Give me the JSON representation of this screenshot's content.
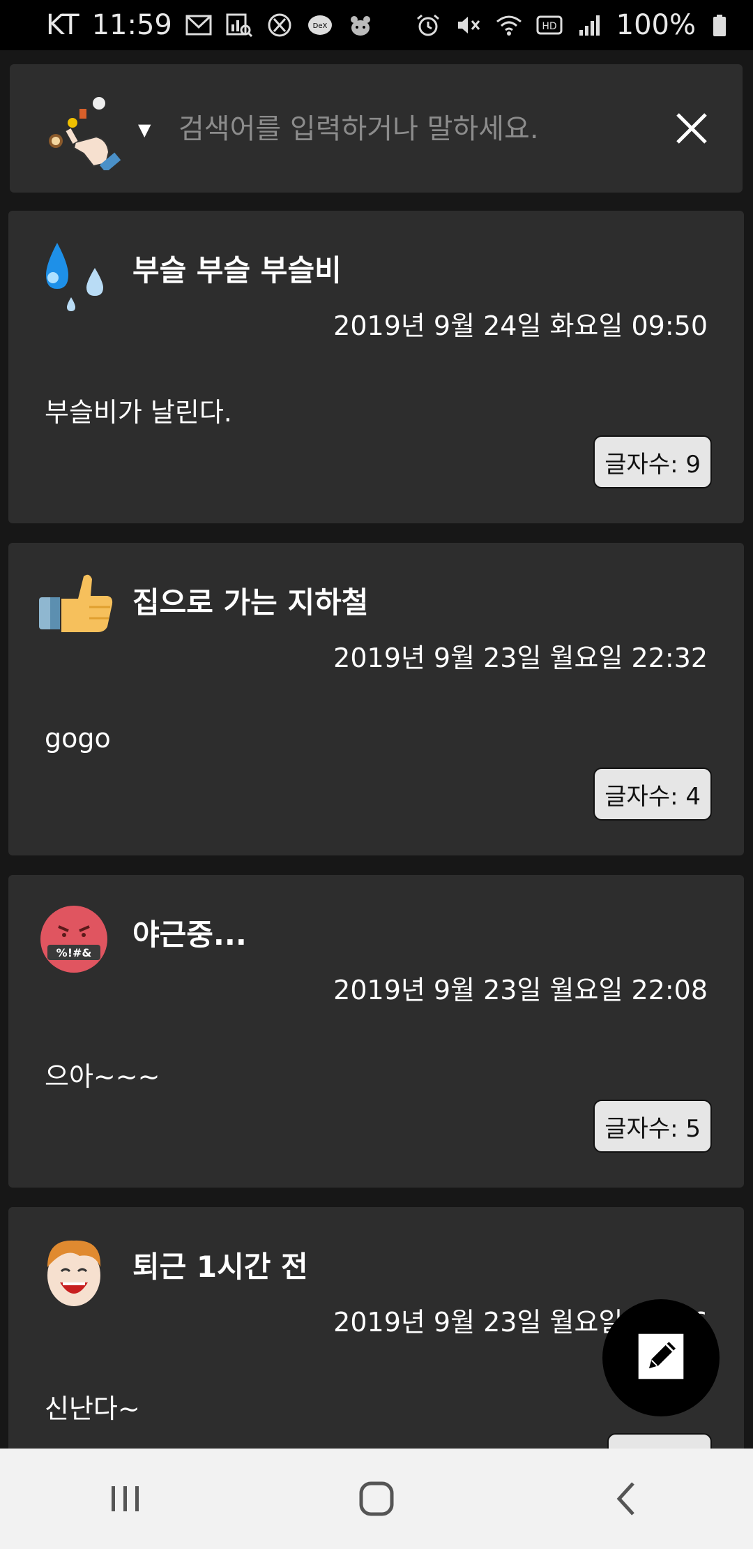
{
  "status_bar": {
    "carrier": "KT",
    "time": "11:59",
    "battery": "100%",
    "left_icons": [
      "gmail-icon",
      "analytics-icon",
      "x-icon",
      "dex-icon",
      "bot-icon"
    ],
    "right_icons": [
      "alarm-icon",
      "mute-icon",
      "wifi-icon",
      "hd-icon",
      "signal-icon",
      "battery-icon"
    ]
  },
  "search": {
    "placeholder": "검색어를 입력하거나 말하세요.",
    "value": "",
    "caret": "▼"
  },
  "entries": [
    {
      "title": "부슬 부슬 부슬비",
      "date": "2019년 9월 24일 화요일 09:50",
      "body": "부슬비가 날린다.",
      "char_count": "글자수: 9",
      "emoji": "droplets-icon"
    },
    {
      "title": "집으로 가는 지하철",
      "date": "2019년 9월 23일 월요일 22:32",
      "body": "gogo",
      "char_count": "글자수: 4",
      "emoji": "thumbs-up-icon"
    },
    {
      "title": "야근중...",
      "date": "2019년 9월 23일 월요일 22:08",
      "body": "으아~~~",
      "char_count": "글자수: 5",
      "emoji": "angry-face-icon"
    },
    {
      "title": "퇴근 1시간 전",
      "date": "2019년 9월 23일 월요일 21:06",
      "body": "신난다~",
      "char_count": "",
      "emoji": "laughing-face-icon"
    }
  ],
  "colors": {
    "background": "#171717",
    "card": "#2d2d2d",
    "badge": "#e6e6e6",
    "fab": "#000000",
    "navbar": "#f2f2f2"
  }
}
